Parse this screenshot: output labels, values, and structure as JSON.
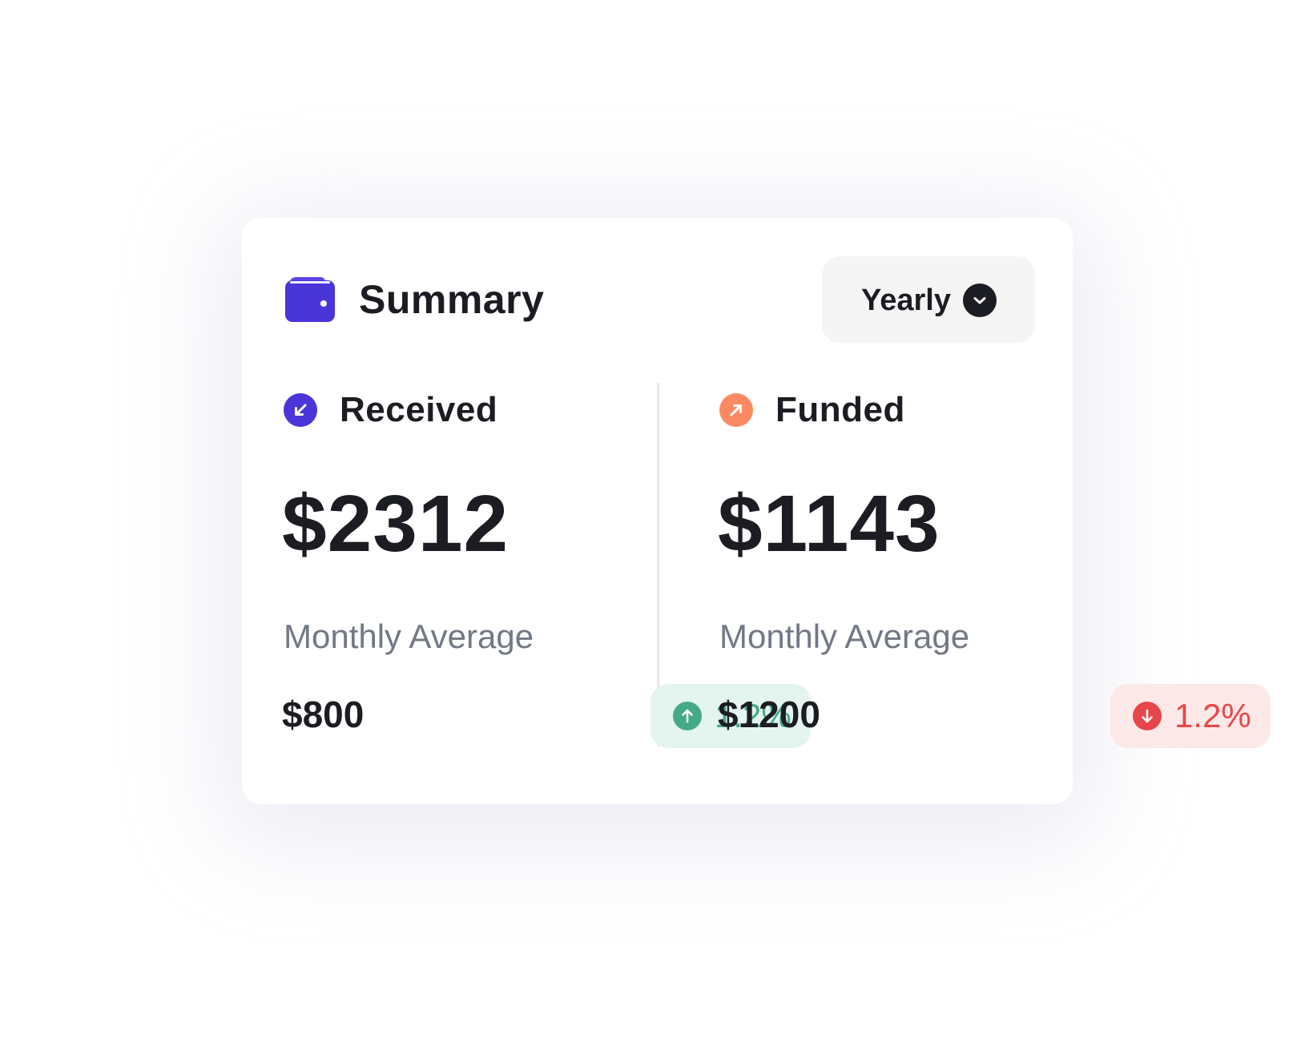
{
  "header": {
    "title": "Summary",
    "icon": "wallet-icon",
    "period_selector": {
      "value": "Yearly",
      "icon": "chevron-down-icon"
    }
  },
  "received": {
    "label": "Received",
    "icon": "arrow-down-left-icon",
    "amount": "$2312",
    "monthly_average_label": "Monthly Average",
    "monthly_average_value": "$800",
    "change": {
      "direction": "up",
      "value": "1.2%",
      "icon": "arrow-up-icon"
    }
  },
  "funded": {
    "label": "Funded",
    "icon": "arrow-up-right-icon",
    "amount": "$1143",
    "monthly_average_label": "Monthly Average",
    "monthly_average_value": "$1200",
    "change": {
      "direction": "down",
      "value": "1.2%",
      "icon": "arrow-down-icon"
    }
  },
  "colors": {
    "brand": "#4a35d9",
    "funded_accent": "#fb8a63",
    "positive": "#45a988",
    "positive_bg": "#e4f4ef",
    "negative": "#e8464a",
    "negative_bg": "#fde8e8",
    "text_primary": "#1c1d22",
    "text_secondary": "#727885"
  }
}
